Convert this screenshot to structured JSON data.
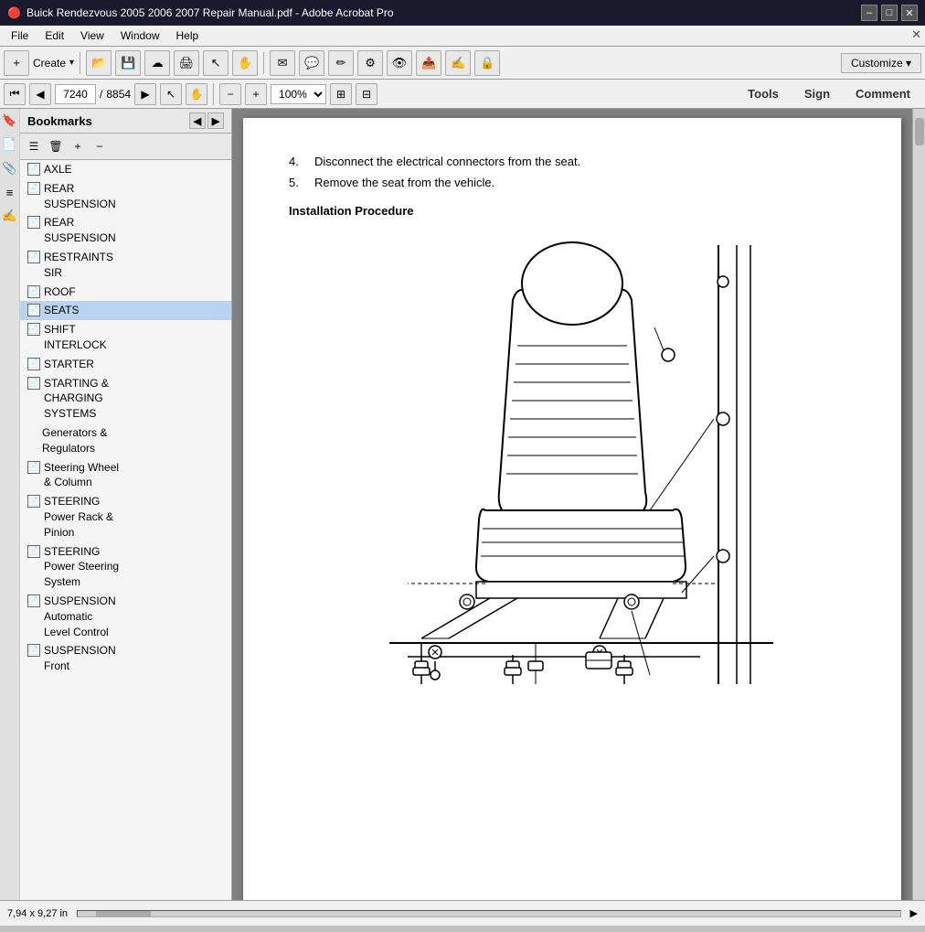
{
  "window": {
    "title": "Buick Rendezvous 2005 2006 2007 Repair Manual.pdf - Adobe Acrobat Pro",
    "min_btn": "–",
    "max_btn": "□",
    "close_btn": "✕"
  },
  "menubar": {
    "items": [
      "File",
      "Edit",
      "View",
      "Window",
      "Help"
    ]
  },
  "toolbar": {
    "create_label": "Create",
    "customize_label": "Customize ▾"
  },
  "nav_toolbar": {
    "current_page": "7240",
    "total_pages": "8854",
    "zoom": "100%",
    "tools_label": "Tools",
    "sign_label": "Sign",
    "comment_label": "Comment"
  },
  "sidebar": {
    "title": "Bookmarks",
    "bookmarks": [
      {
        "label": "AXLE",
        "selected": false
      },
      {
        "label": "REAR SUSPENSION",
        "selected": false
      },
      {
        "label": "REAR SUSPENSION",
        "selected": false
      },
      {
        "label": "RESTRAINTS SIR",
        "selected": false
      },
      {
        "label": "ROOF",
        "selected": false
      },
      {
        "label": "SEATS",
        "selected": true
      },
      {
        "label": "SHIFT INTERLOCK",
        "selected": false
      },
      {
        "label": "STARTER",
        "selected": false
      },
      {
        "label": "STARTING & CHARGING SYSTEMS",
        "selected": false
      },
      {
        "label": "Generators & Regulators",
        "selected": false,
        "indent": true
      },
      {
        "label": "Steering Wheel & Column",
        "selected": false
      },
      {
        "label": "STEERING Power Rack & Pinion",
        "selected": false
      },
      {
        "label": "STEERING Power Steering System",
        "selected": false
      },
      {
        "label": "SUSPENSION Automatic Level Control",
        "selected": false
      },
      {
        "label": "SUSPENSION Front",
        "selected": false
      }
    ]
  },
  "pdf": {
    "steps": [
      {
        "num": "4.",
        "text": "Disconnect the electrical connectors from the seat."
      },
      {
        "num": "5.",
        "text": "Remove the seat from the vehicle."
      }
    ],
    "heading": "Installation Procedure"
  },
  "status_bar": {
    "dimensions": "7,94 x 9,27 in"
  }
}
